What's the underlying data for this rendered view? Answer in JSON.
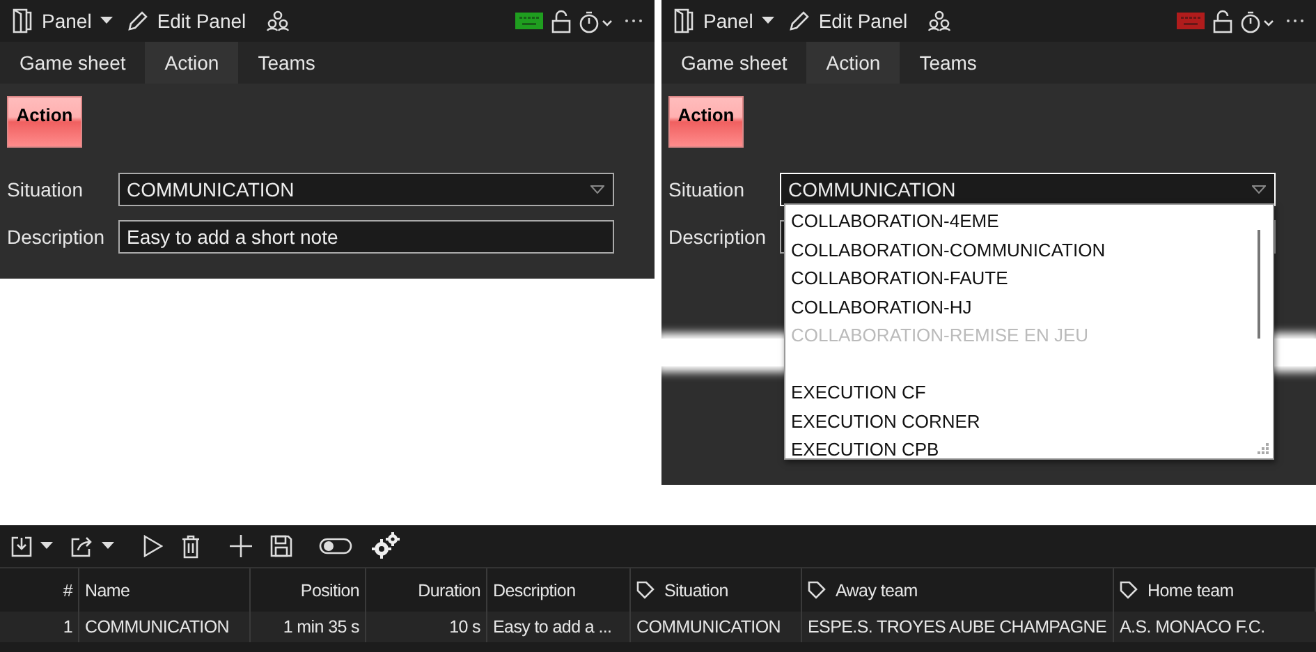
{
  "panels": [
    {
      "toolbar": {
        "panel_label": "Panel",
        "edit_label": "Edit Panel",
        "keyboard": {
          "color": "#1f9e1f"
        }
      },
      "tabs": [
        {
          "label": "Game sheet",
          "selected": false
        },
        {
          "label": "Action",
          "selected": true
        },
        {
          "label": "Teams",
          "selected": false
        }
      ],
      "action_button": "Action",
      "fields": [
        {
          "kind": "dropdown",
          "label": "Situation",
          "value": "COMMUNICATION",
          "expanded": false
        },
        {
          "kind": "text",
          "label": "Description",
          "value": "Easy to add a short note"
        }
      ]
    },
    {
      "toolbar": {
        "panel_label": "Panel",
        "edit_label": "Edit Panel",
        "keyboard": {
          "color": "#b01c1c"
        }
      },
      "tabs": [
        {
          "label": "Game sheet",
          "selected": false
        },
        {
          "label": "Action",
          "selected": true
        },
        {
          "label": "Teams",
          "selected": false
        }
      ],
      "action_button": "Action",
      "fields": [
        {
          "kind": "dropdown",
          "label": "Situation",
          "value": "COMMUNICATION",
          "expanded": true,
          "options": [
            {
              "label": "COLLABORATION-4EME",
              "faded": false
            },
            {
              "label": "COLLABORATION-COMMUNICATION",
              "faded": false
            },
            {
              "label": "COLLABORATION-FAUTE",
              "faded": false
            },
            {
              "label": "COLLABORATION-HJ",
              "faded": false
            },
            {
              "label": "COLLABORATION-REMISE EN JEU",
              "faded": true
            },
            {
              "label": "EXECUTION CF",
              "faded": false
            },
            {
              "label": "EXECUTION CORNER",
              "faded": false
            },
            {
              "label": "EXECUTION CPB",
              "faded": false
            }
          ]
        },
        {
          "kind": "text",
          "label": "Description"
        }
      ]
    }
  ],
  "table": {
    "columns": [
      {
        "label": "#",
        "tag": false
      },
      {
        "label": "Name",
        "tag": false
      },
      {
        "label": "Position",
        "tag": false
      },
      {
        "label": "Duration",
        "tag": false
      },
      {
        "label": "Description",
        "tag": false
      },
      {
        "label": "Situation",
        "tag": true
      },
      {
        "label": "Away team",
        "tag": true
      },
      {
        "label": "Home team",
        "tag": true
      }
    ],
    "rows": [
      {
        "cells": [
          "1",
          "COMMUNICATION",
          "1 min 35 s",
          "10 s",
          "Easy to add a ...",
          "COMMUNICATION",
          "ESPE.S. TROYES AUBE CHAMPAGNE",
          "A.S. MONACO F.C."
        ]
      }
    ]
  }
}
